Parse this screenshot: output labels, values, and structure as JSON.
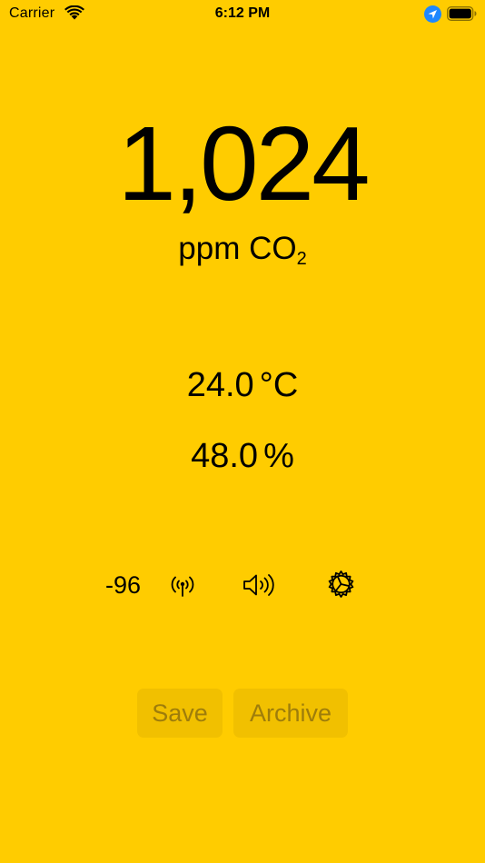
{
  "status_bar": {
    "carrier": "Carrier",
    "time": "6:12 PM",
    "icons": [
      "wifi-icon",
      "location-icon",
      "battery-icon"
    ]
  },
  "reading": {
    "co2_value": "1,024",
    "co2_unit_prefix": "ppm CO",
    "co2_unit_subscript": "2",
    "temperature_value": "24.0",
    "temperature_unit": "°C",
    "humidity_value": "48.0",
    "humidity_unit": "%"
  },
  "device_status": {
    "rssi": "-96",
    "icons": [
      "antenna-icon",
      "speaker-icon",
      "gear-icon"
    ]
  },
  "actions": {
    "save_label": "Save",
    "archive_label": "Archive"
  },
  "colors": {
    "background": "#FFCC00",
    "text": "#000000",
    "location_accent": "#1E88FF"
  }
}
